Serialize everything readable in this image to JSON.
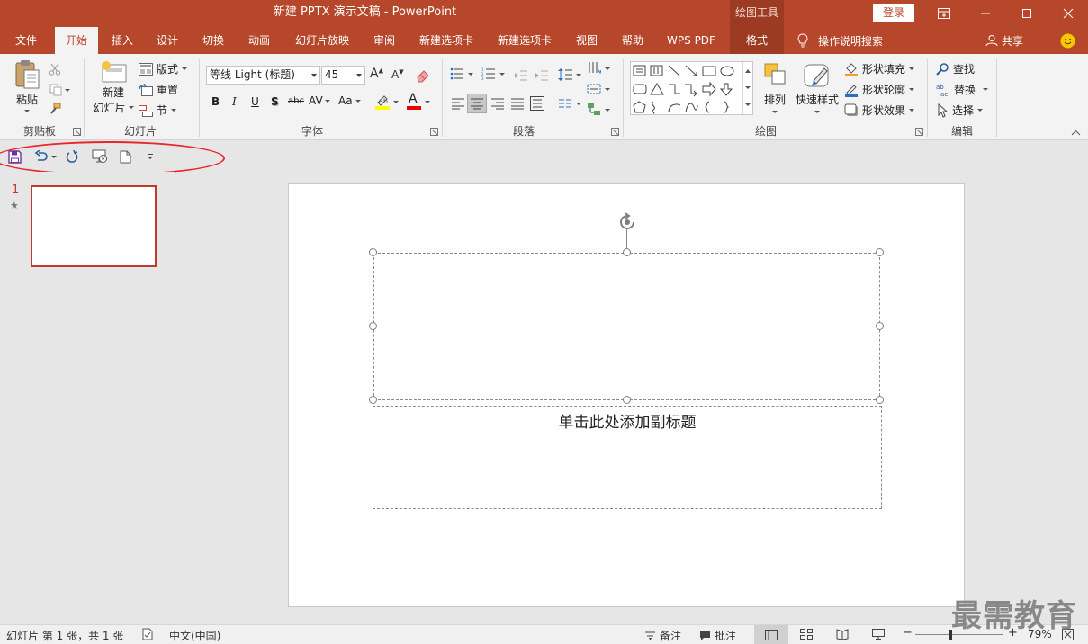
{
  "window": {
    "title": "新建 PPTX 演示文稿  -  PowerPoint",
    "context_group": "绘图工具",
    "login": "登录"
  },
  "tabs": [
    "文件",
    "开始",
    "插入",
    "设计",
    "切换",
    "动画",
    "幻灯片放映",
    "审阅",
    "新建选项卡",
    "新建选项卡",
    "视图",
    "帮助",
    "WPS PDF",
    "格式"
  ],
  "tell_me": "操作说明搜索",
  "share": "共享",
  "groups": {
    "clipboard": "剪贴板",
    "slides": "幻灯片",
    "font": "字体",
    "paragraph": "段落",
    "drawing": "绘图",
    "editing": "编辑"
  },
  "clipboard": {
    "paste": "粘贴"
  },
  "slides": {
    "new_slide_line1": "新建",
    "new_slide_line2": "幻灯片",
    "layout": "版式",
    "reset": "重置",
    "section": "节"
  },
  "font": {
    "name": "等线 Light (标题)",
    "size": "45",
    "bold": "B",
    "italic": "I",
    "underline": "U",
    "shadow": "S",
    "strike": "abc",
    "spacing": "AV",
    "case": "Aa",
    "grow": "A",
    "shrink": "A",
    "color": "A"
  },
  "drawing": {
    "arrange": "排列",
    "quick_styles": "快速样式",
    "fill": "形状填充",
    "outline": "形状轮廓",
    "effects": "形状效果"
  },
  "editing": {
    "find": "查找",
    "replace": "替换",
    "select": "选择"
  },
  "thumbnails": [
    {
      "number": "1",
      "star": "★"
    }
  ],
  "slide": {
    "subtitle_placeholder": "单击此处添加副标题"
  },
  "status": {
    "slide_info": "幻灯片 第 1 张，共 1 张",
    "language": "中文(中国)",
    "notes": "备注",
    "comments": "批注",
    "zoom": "79%",
    "zoom_level": 0.79
  },
  "watermark": "最需教育",
  "colors": {
    "brand": "#b7472a",
    "ribbon": "#f3f3f3",
    "highlight_circle": "#e8262b"
  }
}
